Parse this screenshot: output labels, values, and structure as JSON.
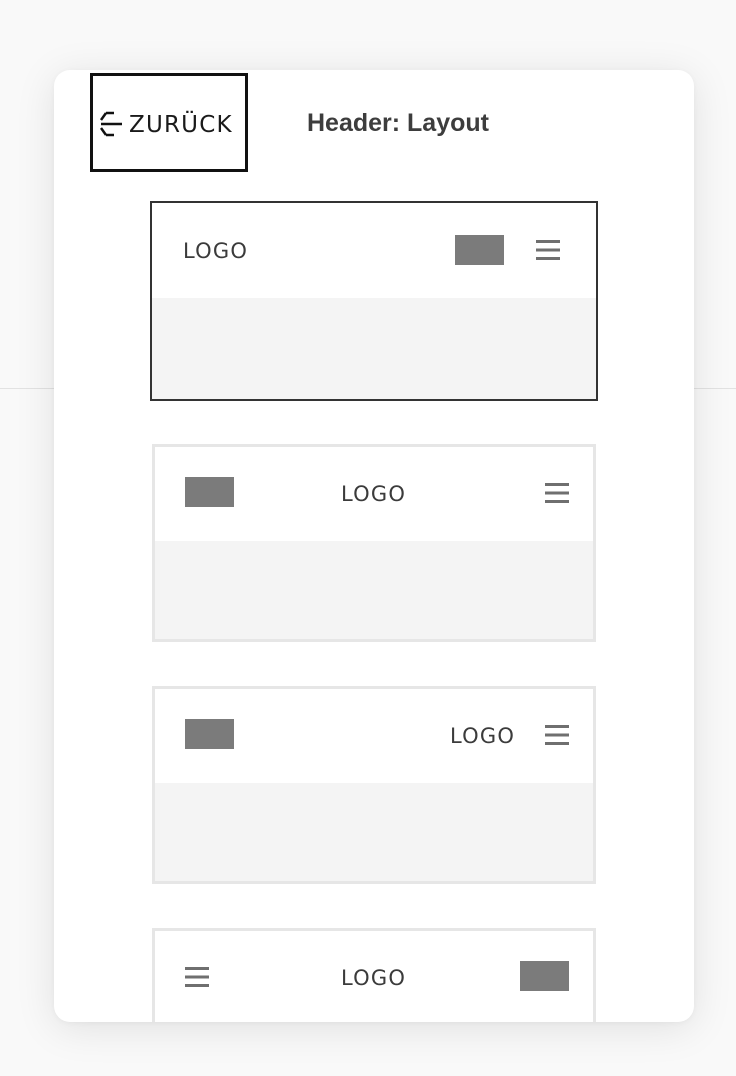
{
  "panel": {
    "back_label": "ZURÜCK",
    "title": "Header: Layout"
  },
  "layouts": [
    {
      "logo": "LOGO",
      "selected": true,
      "arrangement": "logo-left, block + menu-icon right"
    },
    {
      "logo": "LOGO",
      "selected": false,
      "arrangement": "block left, logo center, menu-icon right"
    },
    {
      "logo": "LOGO",
      "selected": false,
      "arrangement": "block left, logo + menu-icon right"
    },
    {
      "logo": "LOGO",
      "selected": false,
      "arrangement": "menu-icon left, logo center, block right"
    }
  ],
  "colors": {
    "selected_border": "#333333",
    "option_border": "#e6e6e6",
    "placeholder_block": "#7b7b7b",
    "preview_body": "#f4f4f4"
  },
  "icons": [
    "back-arrow-icon",
    "hamburger-menu-icon"
  ]
}
